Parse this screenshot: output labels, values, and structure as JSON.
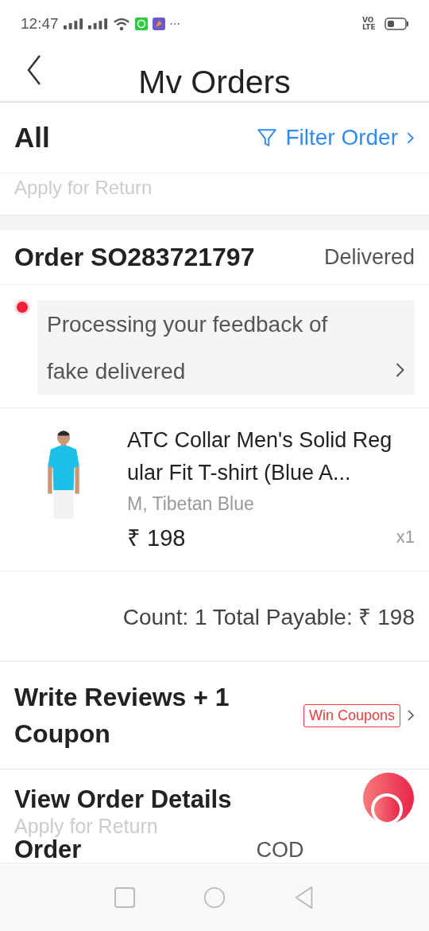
{
  "status_bar": {
    "time": "12:47",
    "more": "···",
    "network": "VO LTE"
  },
  "header": {
    "title": "Mv Orders"
  },
  "filter_bar": {
    "label": "All",
    "filter": "Filter Order",
    "hint": "Apply for Return"
  },
  "order": {
    "number": "Order SO283721797",
    "status": "Delivered",
    "notice": {
      "text": "Processing your feedback of fake delivered",
      "unread": true
    },
    "product": {
      "kind": "picture",
      "name": "ATC Collar Men's Solid Regular Fit T-shirt (Blue A...",
      "variant": "M, Tibetan Blue",
      "price": "₹ 198",
      "quantity": "x1"
    },
    "summary": "Count: 1 Total Payable: ₹ 198",
    "review": {
      "title": "Write Reviews + 1 Coupon",
      "badge": "Win Coupons"
    },
    "details": {
      "title": "View Order Details",
      "hint": "Apply for Return",
      "label": "Order",
      "payment": "COD"
    }
  }
}
